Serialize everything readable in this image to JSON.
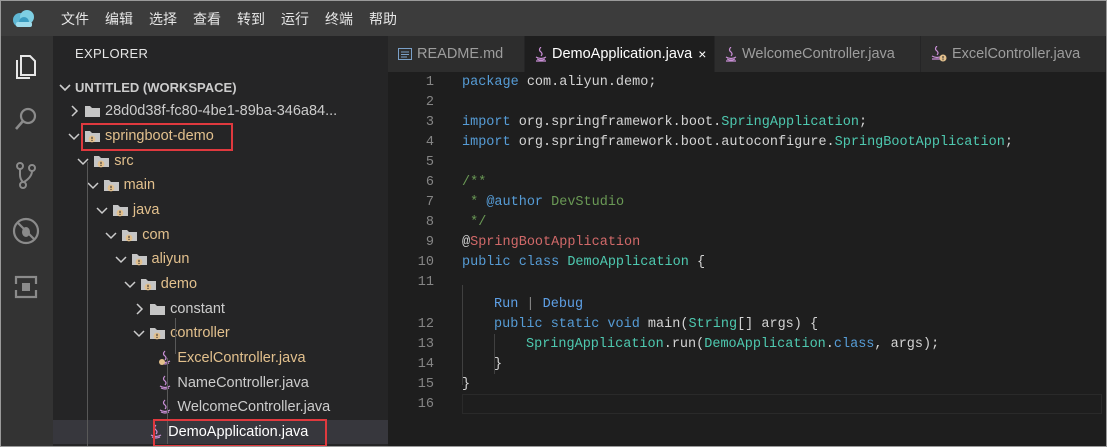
{
  "menubar": {
    "logo_icon": "cloud-logo-icon",
    "items": [
      "文件",
      "编辑",
      "选择",
      "查看",
      "转到",
      "运行",
      "终端",
      "帮助"
    ]
  },
  "activitybar": {
    "icons": [
      "explorer-icon",
      "search-icon",
      "source-control-icon",
      "debug-icon",
      "extensions-icon"
    ]
  },
  "sidebar": {
    "title": "EXPLORER",
    "workspace": "UNTITLED (WORKSPACE)",
    "tree": [
      {
        "label": "28d0d38f-fc80-4be1-89ba-346a84...",
        "kind": "folder",
        "state": "collapsed",
        "depth": 0
      },
      {
        "label": "springboot-demo",
        "kind": "folder",
        "state": "expanded",
        "depth": 0
      },
      {
        "label": "src",
        "kind": "folder",
        "state": "expanded",
        "depth": 1
      },
      {
        "label": "main",
        "kind": "folder",
        "state": "expanded",
        "depth": 2
      },
      {
        "label": "java",
        "kind": "folder",
        "state": "expanded",
        "depth": 3
      },
      {
        "label": "com",
        "kind": "folder",
        "state": "expanded",
        "depth": 4
      },
      {
        "label": "aliyun",
        "kind": "folder",
        "state": "expanded",
        "depth": 5
      },
      {
        "label": "demo",
        "kind": "folder",
        "state": "expanded",
        "depth": 6
      },
      {
        "label": "constant",
        "kind": "folder",
        "state": "collapsed",
        "depth": 7
      },
      {
        "label": "controller",
        "kind": "folder",
        "state": "expanded",
        "depth": 7
      },
      {
        "label": "ExcelController.java",
        "kind": "java",
        "depth": 8
      },
      {
        "label": "NameController.java",
        "kind": "java",
        "depth": 8
      },
      {
        "label": "WelcomeController.java",
        "kind": "java",
        "depth": 8
      },
      {
        "label": "DemoApplication.java",
        "kind": "java",
        "depth": 7
      }
    ]
  },
  "tabs": [
    {
      "label": "README.md",
      "icon": "markdown-icon",
      "active": false
    },
    {
      "label": "DemoApplication.java",
      "icon": "java-icon",
      "active": true,
      "close": "×"
    },
    {
      "label": "WelcomeController.java",
      "icon": "java-icon",
      "active": false
    },
    {
      "label": "ExcelController.java",
      "icon": "java-warning-icon",
      "active": false
    }
  ],
  "editor": {
    "line_numbers": [
      "1",
      "2",
      "3",
      "4",
      "5",
      "6",
      "7",
      "8",
      "9",
      "10",
      "11",
      "12",
      "13",
      "14",
      "15",
      "16"
    ],
    "code": {
      "l1_kw": "package",
      "l1_rest": " com.aliyun.demo;",
      "l3_kw": "import",
      "l3_pkg": " org.springframework.boot.",
      "l3_cls": "SpringApplication",
      "l3_end": ";",
      "l4_kw": "import",
      "l4_pkg": " org.springframework.boot.autoconfigure.",
      "l4_cls": "SpringBootApplication",
      "l4_end": ";",
      "l6": "/**",
      "l7_star": " * ",
      "l7_tag": "@author",
      "l7_name": " DevStudio",
      "l8": " */",
      "l9_at": "@",
      "l9_ann": "SpringBootApplication",
      "l10_kw1": "public",
      "l10_kw2": " class ",
      "l10_cls": "DemoApplication",
      "l10_end": " {",
      "lens_run": "Run",
      "lens_sep": " | ",
      "lens_debug": "Debug",
      "l12_kw": "public static void",
      "l12_fn": " main",
      "l12_open": "(",
      "l12_type": "String",
      "l12_rest": "[] args) {",
      "l13_cls": "SpringApplication",
      "l13_mid": ".run(",
      "l13_cls2": "DemoApplication",
      "l13_dot": ".",
      "l13_kw": "class",
      "l13_end": ", args);",
      "l14": "}",
      "l15": "}"
    }
  },
  "colors": {
    "highlight_box": "#e0393e",
    "folder_label": "#e2c08d",
    "keyword": "#569cd6",
    "type": "#4ec9b0"
  }
}
